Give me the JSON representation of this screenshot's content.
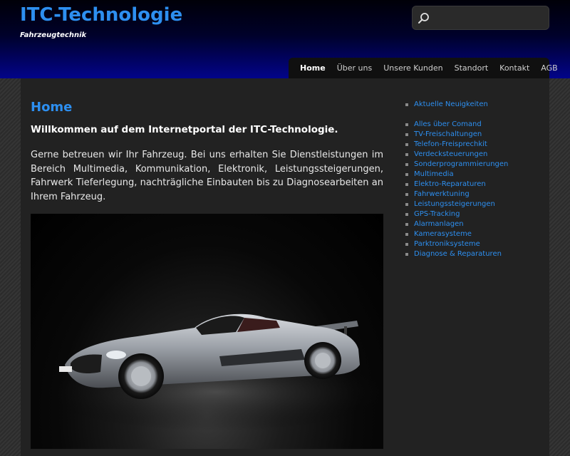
{
  "header": {
    "site_title": "ITC-Technologie",
    "site_description": "Fahrzeugtechnik",
    "search": {
      "value": "",
      "placeholder": ""
    }
  },
  "nav": {
    "items": [
      {
        "label": "Home",
        "active": true
      },
      {
        "label": "Über uns"
      },
      {
        "label": "Unsere Kunden"
      },
      {
        "label": "Standort"
      },
      {
        "label": "Kontakt"
      },
      {
        "label": "AGB"
      }
    ]
  },
  "main": {
    "title": "Home",
    "welcome": "Willkommen auf dem Internetportal der ITC-Technologie.",
    "intro": "Gerne betreuen wir Ihr Fahrzeug. Bei uns erhalten Sie Dienstleistungen im Bereich Multimedia, Kommunikation, Elektronik, Leistungssteigerungen, Fahrwerk Tieferlegung, nachträgliche Einbauten bis zu Diagnosearbeiten an Ihrem Fahrzeug."
  },
  "sidebar": {
    "top_item": "Aktuelle Neuigkeiten",
    "items": [
      "Alles über Comand",
      "TV-Freischaltungen",
      "Telefon-Freisprechkit",
      "Verdecksteuerungen",
      "Sonderprogrammierungen",
      "Multimedia",
      "Elektro-Reparaturen",
      "Fahrwerktuning",
      "Leistungssteigerungen",
      "GPS-Tracking",
      "Alarmanlagen",
      "Kamerasysteme",
      "Parktroniksysteme",
      "Diagnose & Reparaturen"
    ]
  },
  "colors": {
    "accent": "#2d8ff0",
    "header_top": "#000008",
    "header_bottom": "#02048a",
    "page_bg": "#222222"
  }
}
